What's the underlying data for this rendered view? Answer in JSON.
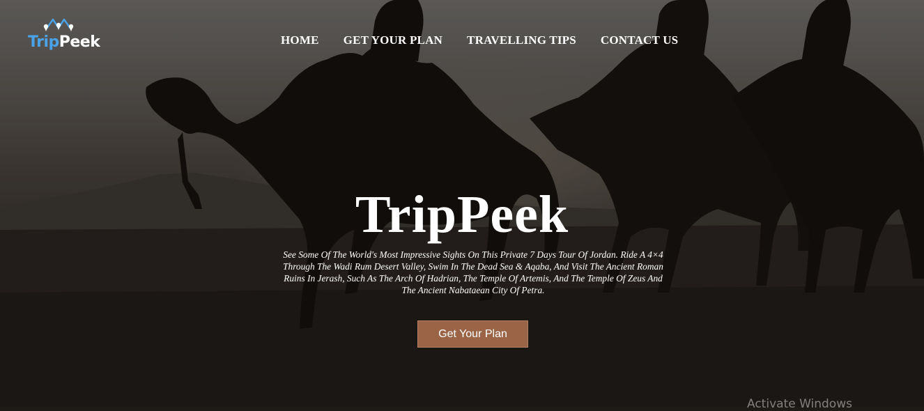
{
  "brand": {
    "logo_part1": "Trip",
    "logo_part2": "Peek",
    "accent_color": "#4aa3e8"
  },
  "nav": {
    "items": [
      {
        "label": "HOME"
      },
      {
        "label": "GET YOUR PLAN"
      },
      {
        "label": "TRAVELLING TIPS"
      },
      {
        "label": "CONTACT US"
      }
    ]
  },
  "hero": {
    "title": "TripPeek",
    "description": "See Some Of The World's Most Impressive Sights On This Private 7 Days Tour Of Jordan. Ride A 4×4 Through The Wadi Rum Desert Valley, Swim In The Dead Sea & Aqaba, And Visit The Ancient Roman Ruins In Jerash, Such As The Arch Of Hadrian, The Temple Of Artemis, And The Temple Of Zeus And The Ancient Nabataean City Of Petra.",
    "cta_label": "Get Your Plan",
    "cta_color": "#9b6446",
    "background_image": "camel caravan silhouettes in desert"
  },
  "system": {
    "watermark": "Activate Windows"
  }
}
